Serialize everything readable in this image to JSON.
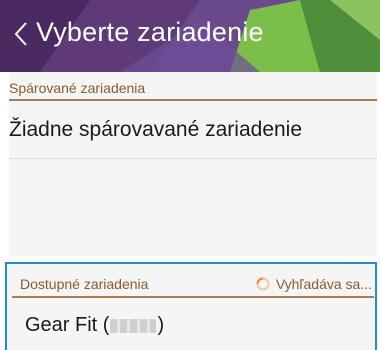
{
  "header": {
    "title": "Vyberte zariadenie",
    "back_icon": "chevron-left-icon",
    "colors": {
      "background": "#55306c",
      "accent_green": "#7bbf4a",
      "accent_purple": "#6c4d9a",
      "title_text": "#ffffff"
    }
  },
  "paired": {
    "label": "Spárované zariadenia",
    "empty_message": "Žiadne spárovavané zariadenie"
  },
  "available": {
    "label": "Dostupné zariadenia",
    "status_text": "Vyhľadáva sa...",
    "status_icon": "loading-spinner-icon",
    "focus_color": "#1f8ecf",
    "devices": [
      {
        "name_prefix": "Gear Fit (",
        "name_id_redacted": "",
        "name_suffix": ")"
      }
    ]
  },
  "colors": {
    "section_label": "#8a5a2e",
    "divider": "#a97c57",
    "list_background": "#f5f5f5"
  }
}
